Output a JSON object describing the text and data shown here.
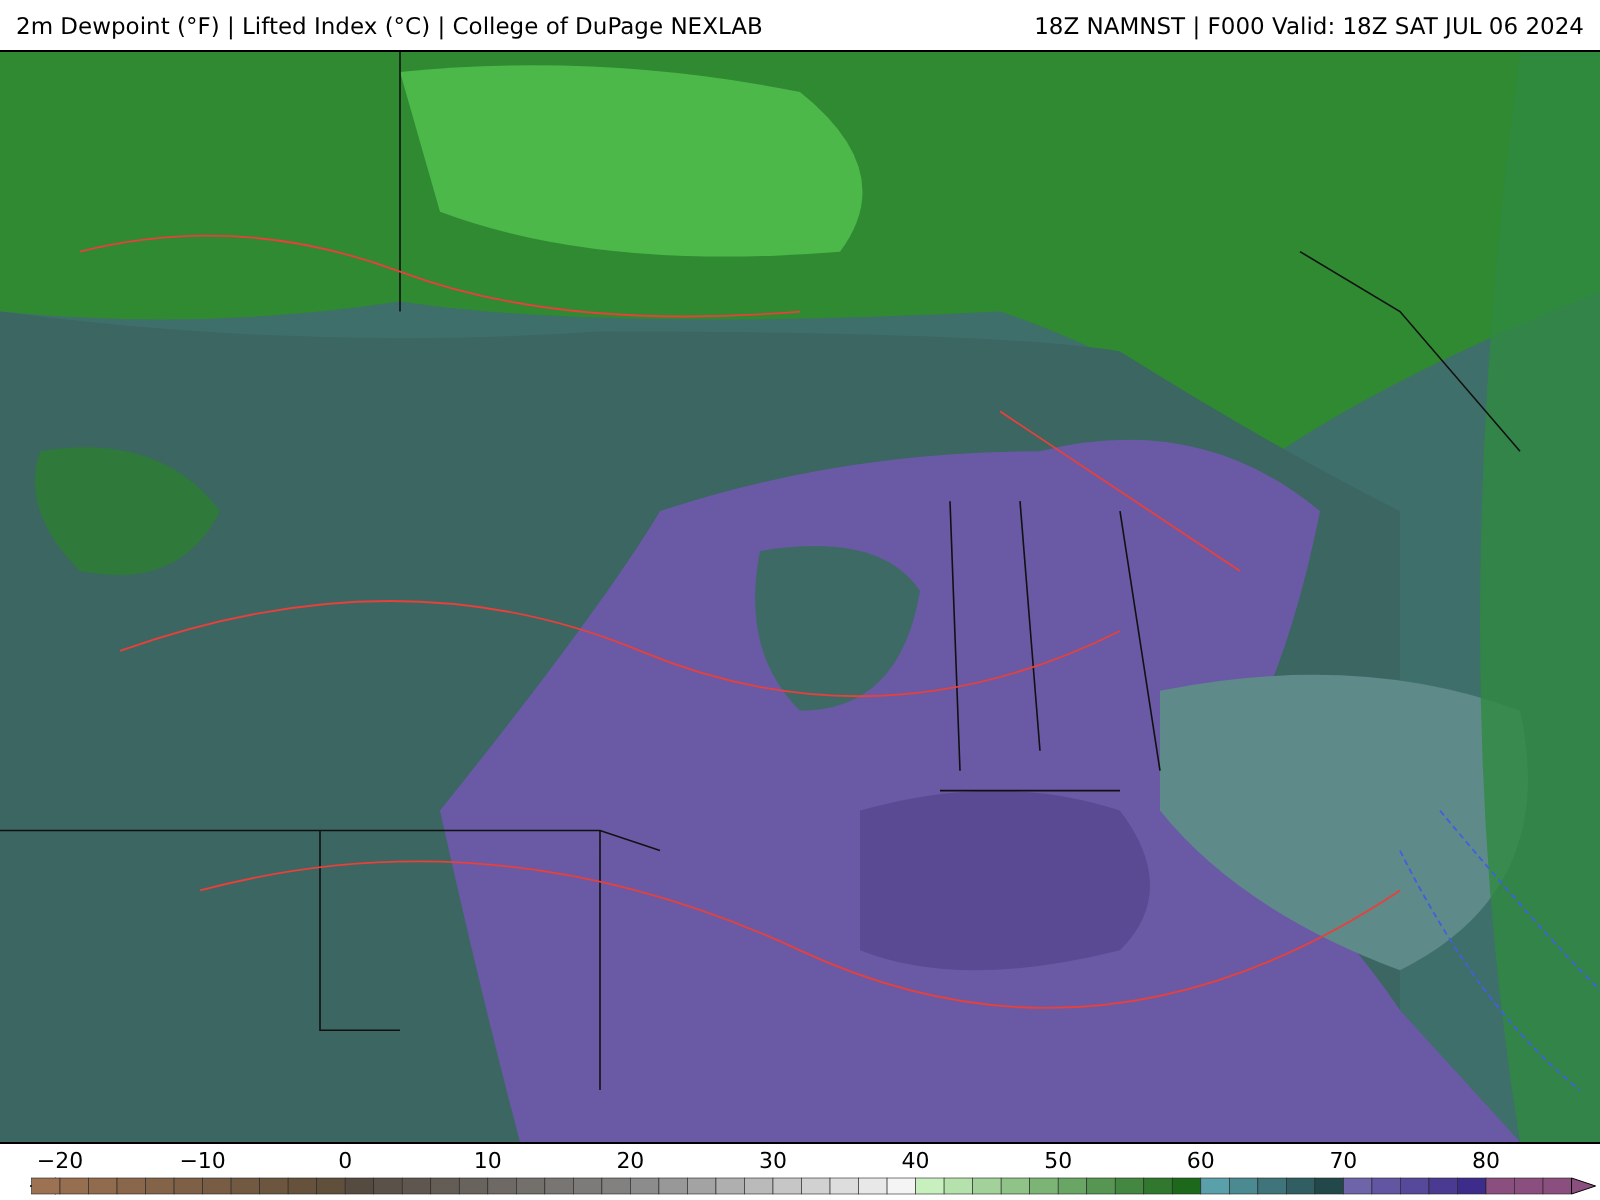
{
  "header": {
    "title": "2m Dewpoint (°F) | Lifted Index (°C) | College of DuPage NEXLAB",
    "run": "18Z NAMNST | F000 Valid: 18Z SAT JUL 06 2024"
  },
  "colorbar": {
    "ticks": [
      "−20",
      "−10",
      "0",
      "10",
      "20",
      "30",
      "40",
      "50",
      "60",
      "70",
      "80"
    ]
  }
}
